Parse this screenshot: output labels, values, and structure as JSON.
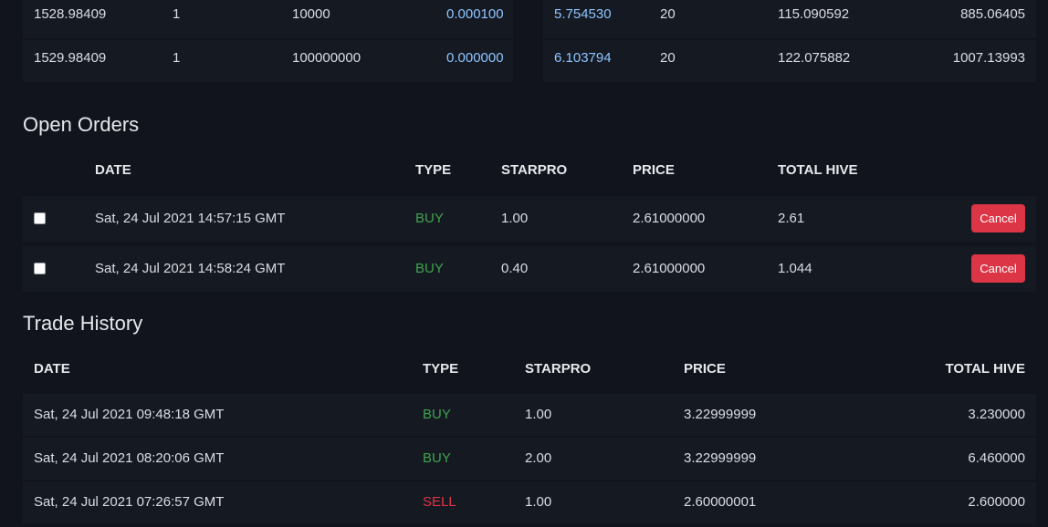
{
  "order_book": [
    {
      "price": "1528.98409",
      "count": "1",
      "amount": "10000",
      "rate": "0.000100",
      "value": "5.754530",
      "depth": "20",
      "total": "115.090592",
      "sum": "885.06405"
    },
    {
      "price": "1529.98409",
      "count": "1",
      "amount": "100000000",
      "rate": "0.000000",
      "value": "6.103794",
      "depth": "20",
      "total": "122.075882",
      "sum": "1007.13993"
    }
  ],
  "open_orders": {
    "title": "Open Orders",
    "headers": {
      "date": "DATE",
      "type": "TYPE",
      "starpro": "STARPRO",
      "price": "PRICE",
      "total": "TOTAL HIVE"
    },
    "rows": [
      {
        "date": "Sat, 24 Jul 2021 14:57:15 GMT",
        "type": "BUY",
        "starpro": "1.00",
        "price": "2.61000000",
        "total": "2.61",
        "cancel": "Cancel"
      },
      {
        "date": "Sat, 24 Jul 2021 14:58:24 GMT",
        "type": "BUY",
        "starpro": "0.40",
        "price": "2.61000000",
        "total": "1.044",
        "cancel": "Cancel"
      }
    ]
  },
  "trade_history": {
    "title": "Trade History",
    "headers": {
      "date": "DATE",
      "type": "TYPE",
      "starpro": "STARPRO",
      "price": "PRICE",
      "total": "TOTAL HIVE"
    },
    "rows": [
      {
        "date": "Sat, 24 Jul 2021 09:48:18 GMT",
        "type": "BUY",
        "starpro": "1.00",
        "price": "3.22999999",
        "total": "3.230000"
      },
      {
        "date": "Sat, 24 Jul 2021 08:20:06 GMT",
        "type": "BUY",
        "starpro": "2.00",
        "price": "3.22999999",
        "total": "6.460000"
      },
      {
        "date": "Sat, 24 Jul 2021 07:26:57 GMT",
        "type": "SELL",
        "starpro": "1.00",
        "price": "2.60000001",
        "total": "2.600000"
      }
    ]
  },
  "colors": {
    "buy": "#3fa34d",
    "sell": "#dc3545",
    "accent_blue": "#8ec5ff",
    "cancel_button": "#dc3545",
    "background": "#11141c",
    "row_background": "#151922"
  }
}
